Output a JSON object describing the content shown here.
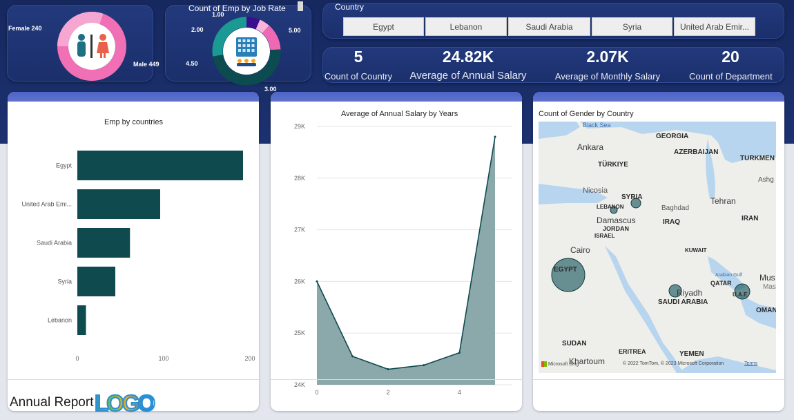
{
  "gender": {
    "female_label": "Female 240",
    "male_label": "Male 449",
    "female": 240,
    "male": 449,
    "colors": {
      "female": "#f5a7d2",
      "male": "#f06fb5"
    }
  },
  "job_rate": {
    "title": "Count of Emp by Job Rate",
    "labels": [
      "1.00",
      "2.00",
      "4.50",
      "5.00",
      "3.00"
    ]
  },
  "country_slicer": {
    "header": "Country",
    "options": [
      "Egypt",
      "Lebanon",
      "Saudi Arabia",
      "Syria",
      "United Arab Emir..."
    ]
  },
  "kpis": [
    {
      "value": "5",
      "label": "Count of Country"
    },
    {
      "value": "24.82K",
      "label": "Average of Annual Salary"
    },
    {
      "value": "2.07K",
      "label": "Average of Monthly Salary"
    },
    {
      "value": "20",
      "label": "Count of Department"
    }
  ],
  "emp_by_countries": {
    "title": "Emp by countries"
  },
  "salary_by_years": {
    "title": "Average of Annual Salary by Years"
  },
  "gender_by_country": {
    "title": "Count of Gender by Country",
    "map_labels": {
      "black_sea": "Black Sea",
      "georgia": "GEORGIA",
      "ankara": "Ankara",
      "azerbaijan": "AZERBAIJAN",
      "turkmen": "TURKMEN",
      "turkiye": "TÜRKIYE",
      "ashg": "Ashg",
      "nicosia": "Nicosia",
      "syria": "SYRIA",
      "lebanon": "LEBANON",
      "baghdad": "Baghdad",
      "tehran": "Tehran",
      "damascus": "Damascus",
      "iraq": "IRAQ",
      "iran": "IRAN",
      "jordan": "JORDAN",
      "israel": "ISRAEL",
      "cairo": "Cairo",
      "kuwait": "KUWAIT",
      "egypt": "EGYPT",
      "arabian_gulf": "Arabian Gulf",
      "mus": "Mus",
      "qatar": "QATAR",
      "mas": "Mas",
      "riyadh": "Riyadh",
      "uae": "U.A.E.",
      "saudi_arabia": "SAUDI ARABIA",
      "oman": "OMAN",
      "sudan": "SUDAN",
      "eritrea": "ERITREA",
      "yemen": "YEMEN",
      "khartoum": "Khartoum",
      "microsoft_bing": "Microsoft Bing",
      "copyright": "© 2022 TomTom, © 2023 Microsoft Corporation",
      "terms": "Terms"
    }
  },
  "footer": {
    "title": "Annual Report",
    "logo_text": "LOGO"
  },
  "chart_data": [
    {
      "type": "bar",
      "title": "Emp by countries",
      "orientation": "horizontal",
      "categories": [
        "Egypt",
        "United Arab Emi...",
        "Saudi Arabia",
        "Syria",
        "Lebanon"
      ],
      "values": [
        192,
        96,
        61,
        44,
        10
      ],
      "x_ticks": [
        "0",
        "100",
        "200"
      ],
      "xlim": [
        0,
        200
      ],
      "color": "#0f4a4f"
    },
    {
      "type": "area",
      "title": "Average of Annual Salary by Years",
      "x": [
        0,
        1,
        2,
        3,
        4,
        5
      ],
      "values": [
        26.0,
        24.55,
        24.3,
        24.38,
        24.62,
        28.8
      ],
      "y_ticks": [
        "24K",
        "25K",
        "26K",
        "27K",
        "28K",
        "29K"
      ],
      "x_ticks": [
        "0",
        "2",
        "4"
      ],
      "ylim": [
        24,
        29
      ],
      "xlim": [
        0,
        5
      ],
      "line_color": "#0f4a4f",
      "fill_color": "#8ba8aa"
    },
    {
      "type": "pie",
      "title": "Count of Emp by Job Rate",
      "categories": [
        "1.00",
        "2.00",
        "4.50",
        "5.00",
        "3.00"
      ],
      "values": [
        28,
        22,
        55,
        210,
        120
      ],
      "colors": [
        "#3a0f8f",
        "#f8b6dc",
        "#ef68b4",
        "#0c4c50",
        "#1a9a93"
      ]
    }
  ]
}
